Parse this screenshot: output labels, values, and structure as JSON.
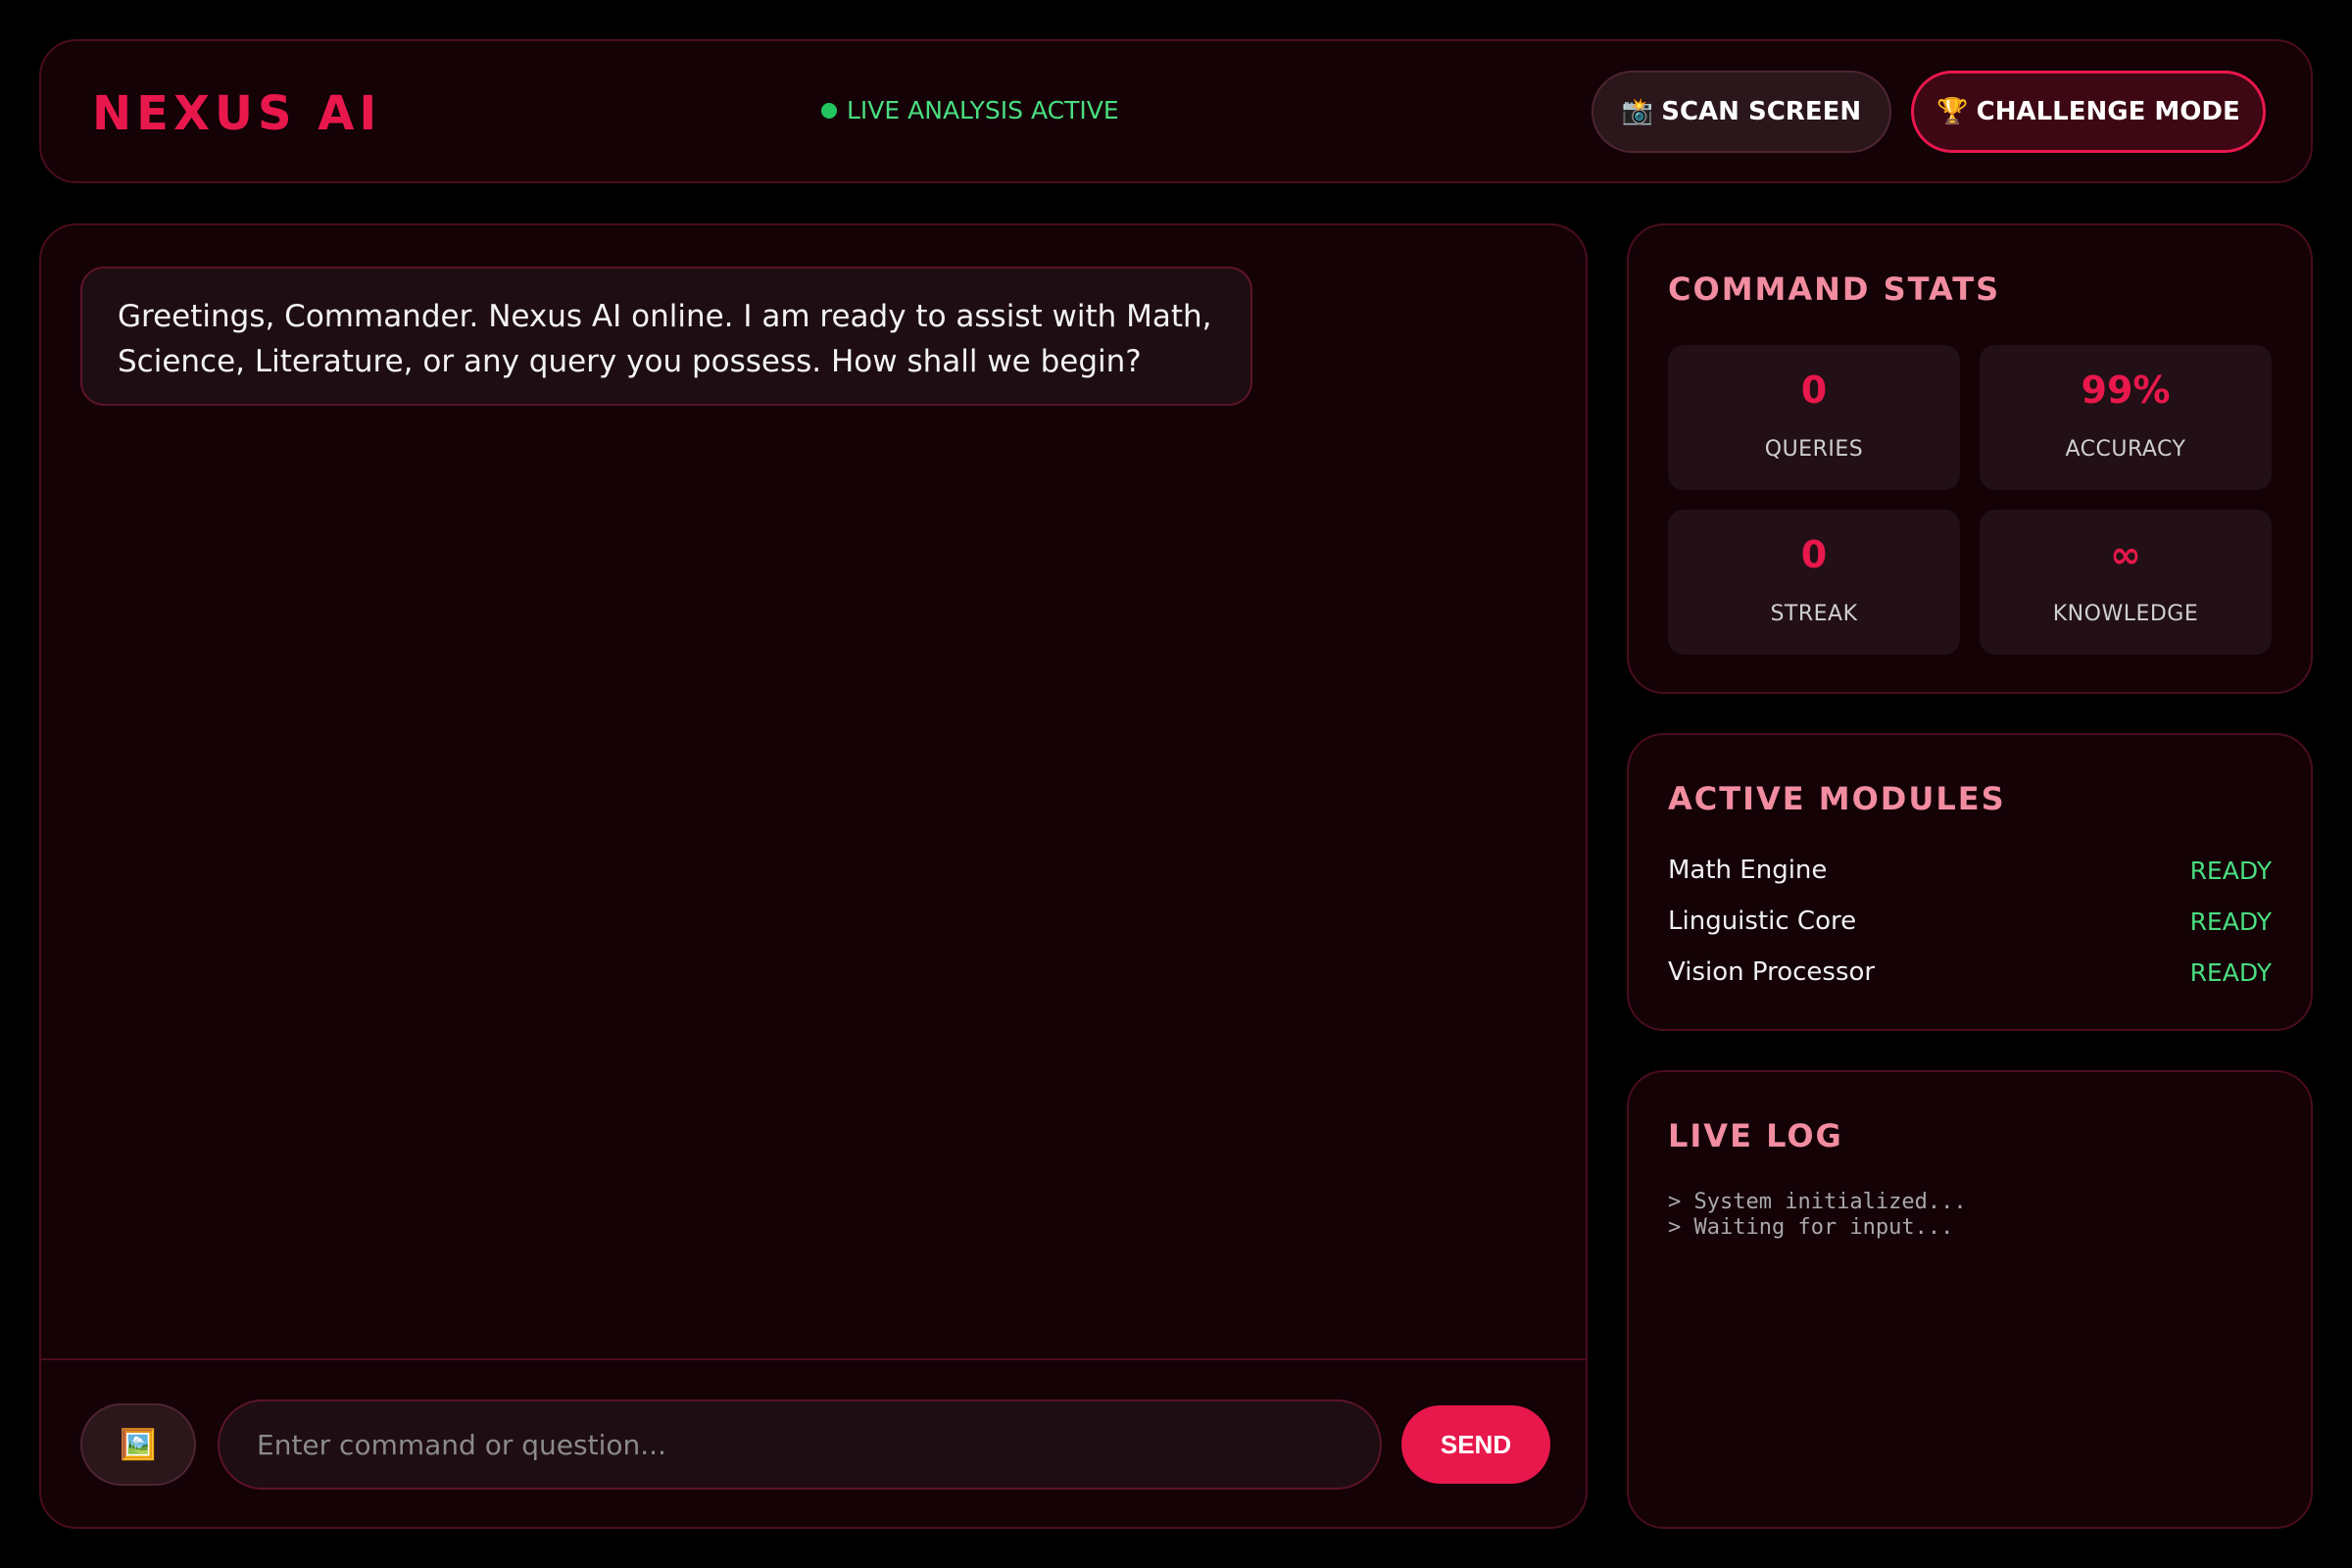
{
  "header": {
    "logo": "NEXUS AI",
    "status": "LIVE ANALYSIS ACTIVE",
    "scan_button": {
      "icon": "camera-icon",
      "icon_glyph": "📸",
      "label": "SCAN SCREEN"
    },
    "challenge_button": {
      "icon": "trophy-icon",
      "icon_glyph": "🏆",
      "label": "CHALLENGE MODE"
    }
  },
  "chat": {
    "messages": [
      {
        "sender": "ai",
        "text": "Greetings, Commander. Nexus AI online. I am ready to assist with Math, Science, Literature, or any query you possess. How shall we begin?"
      }
    ],
    "image_button": {
      "icon": "image-icon",
      "icon_glyph": "🖼️"
    },
    "input": {
      "placeholder": "Enter command or question...",
      "value": ""
    },
    "send_label": "SEND"
  },
  "stats": {
    "title": "COMMAND STATS",
    "items": [
      {
        "value": "0",
        "label": "QUERIES"
      },
      {
        "value": "99%",
        "label": "ACCURACY"
      },
      {
        "value": "0",
        "label": "STREAK"
      },
      {
        "value": "∞",
        "label": "KNOWLEDGE"
      }
    ]
  },
  "modules": {
    "title": "ACTIVE MODULES",
    "items": [
      {
        "name": "Math Engine",
        "status": "READY"
      },
      {
        "name": "Linguistic Core",
        "status": "READY"
      },
      {
        "name": "Vision Processor",
        "status": "READY"
      }
    ]
  },
  "log": {
    "title": "LIVE LOG",
    "lines": [
      "> System initialized...",
      "> Waiting for input..."
    ]
  },
  "colors": {
    "accent": "#e8184c",
    "title_pink": "#f28ca0",
    "ready_green": "#4ade80",
    "panel_bg": "#140207"
  }
}
